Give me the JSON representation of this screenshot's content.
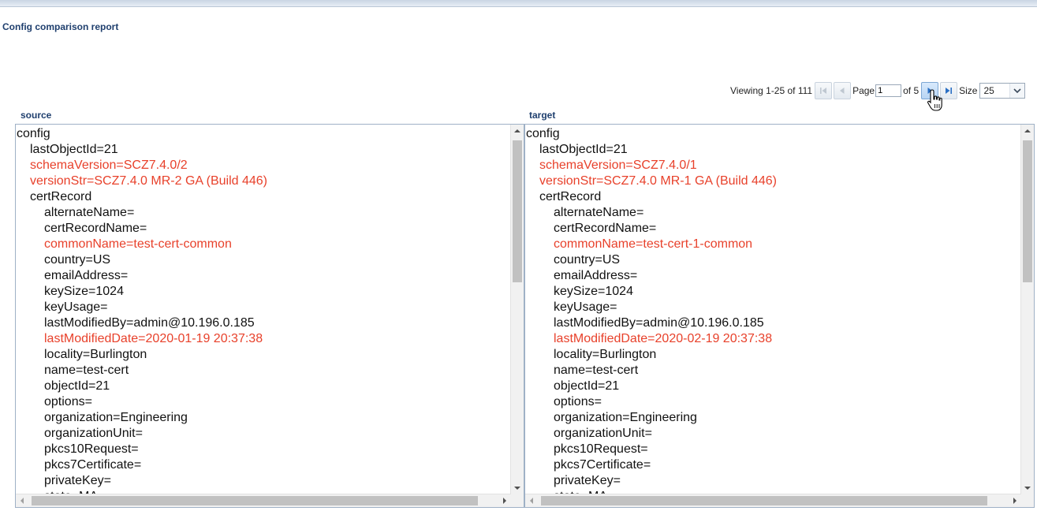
{
  "report": {
    "title": "Config comparison report"
  },
  "pager": {
    "viewing": "Viewing 1-25 of 111",
    "page_label": "Page",
    "page_value": "1",
    "of_label": "of 5",
    "size_label": "Size",
    "size_value": "25"
  },
  "colors": {
    "diff": "#e8412b",
    "title": "#1f3f6e"
  },
  "source": {
    "title": "source",
    "lines": [
      {
        "text": "config",
        "level": 0,
        "diff": false
      },
      {
        "text": "lastObjectId=21",
        "level": 1,
        "diff": false
      },
      {
        "text": "schemaVersion=SCZ7.4.0/2",
        "level": 1,
        "diff": true
      },
      {
        "text": "versionStr=SCZ7.4.0 MR-2 GA (Build 446)",
        "level": 1,
        "diff": true
      },
      {
        "text": "certRecord",
        "level": 1,
        "diff": false
      },
      {
        "text": "alternateName=",
        "level": 2,
        "diff": false
      },
      {
        "text": "certRecordName=",
        "level": 2,
        "diff": false
      },
      {
        "text": "commonName=test-cert-common",
        "level": 2,
        "diff": true
      },
      {
        "text": "country=US",
        "level": 2,
        "diff": false
      },
      {
        "text": "emailAddress=",
        "level": 2,
        "diff": false
      },
      {
        "text": "keySize=1024",
        "level": 2,
        "diff": false
      },
      {
        "text": "keyUsage=",
        "level": 2,
        "diff": false
      },
      {
        "text": "lastModifiedBy=admin@10.196.0.185",
        "level": 2,
        "diff": false
      },
      {
        "text": "lastModifiedDate=2020-01-19 20:37:38",
        "level": 2,
        "diff": true
      },
      {
        "text": "locality=Burlington",
        "level": 2,
        "diff": false
      },
      {
        "text": "name=test-cert",
        "level": 2,
        "diff": false
      },
      {
        "text": "objectId=21",
        "level": 2,
        "diff": false
      },
      {
        "text": "options=",
        "level": 2,
        "diff": false
      },
      {
        "text": "organization=Engineering",
        "level": 2,
        "diff": false
      },
      {
        "text": "organizationUnit=",
        "level": 2,
        "diff": false
      },
      {
        "text": "pkcs10Request=",
        "level": 2,
        "diff": false
      },
      {
        "text": "pkcs7Certificate=",
        "level": 2,
        "diff": false
      },
      {
        "text": "privateKey=",
        "level": 2,
        "diff": false
      },
      {
        "text": "state=MA",
        "level": 2,
        "diff": false
      }
    ]
  },
  "target": {
    "title": "target",
    "lines": [
      {
        "text": "config",
        "level": 0,
        "diff": false
      },
      {
        "text": "lastObjectId=21",
        "level": 1,
        "diff": false
      },
      {
        "text": "schemaVersion=SCZ7.4.0/1",
        "level": 1,
        "diff": true
      },
      {
        "text": "versionStr=SCZ7.4.0 MR-1 GA (Build 446)",
        "level": 1,
        "diff": true
      },
      {
        "text": "certRecord",
        "level": 1,
        "diff": false
      },
      {
        "text": "alternateName=",
        "level": 2,
        "diff": false
      },
      {
        "text": "certRecordName=",
        "level": 2,
        "diff": false
      },
      {
        "text": "commonName=test-cert-1-common",
        "level": 2,
        "diff": true
      },
      {
        "text": "country=US",
        "level": 2,
        "diff": false
      },
      {
        "text": "emailAddress=",
        "level": 2,
        "diff": false
      },
      {
        "text": "keySize=1024",
        "level": 2,
        "diff": false
      },
      {
        "text": "keyUsage=",
        "level": 2,
        "diff": false
      },
      {
        "text": "lastModifiedBy=admin@10.196.0.185",
        "level": 2,
        "diff": false
      },
      {
        "text": "lastModifiedDate=2020-02-19 20:37:38",
        "level": 2,
        "diff": true
      },
      {
        "text": "locality=Burlington",
        "level": 2,
        "diff": false
      },
      {
        "text": "name=test-cert",
        "level": 2,
        "diff": false
      },
      {
        "text": "objectId=21",
        "level": 2,
        "diff": false
      },
      {
        "text": "options=",
        "level": 2,
        "diff": false
      },
      {
        "text": "organization=Engineering",
        "level": 2,
        "diff": false
      },
      {
        "text": "organizationUnit=",
        "level": 2,
        "diff": false
      },
      {
        "text": "pkcs10Request=",
        "level": 2,
        "diff": false
      },
      {
        "text": "pkcs7Certificate=",
        "level": 2,
        "diff": false
      },
      {
        "text": "privateKey=",
        "level": 2,
        "diff": false
      },
      {
        "text": "state=MA",
        "level": 2,
        "diff": false
      }
    ]
  }
}
